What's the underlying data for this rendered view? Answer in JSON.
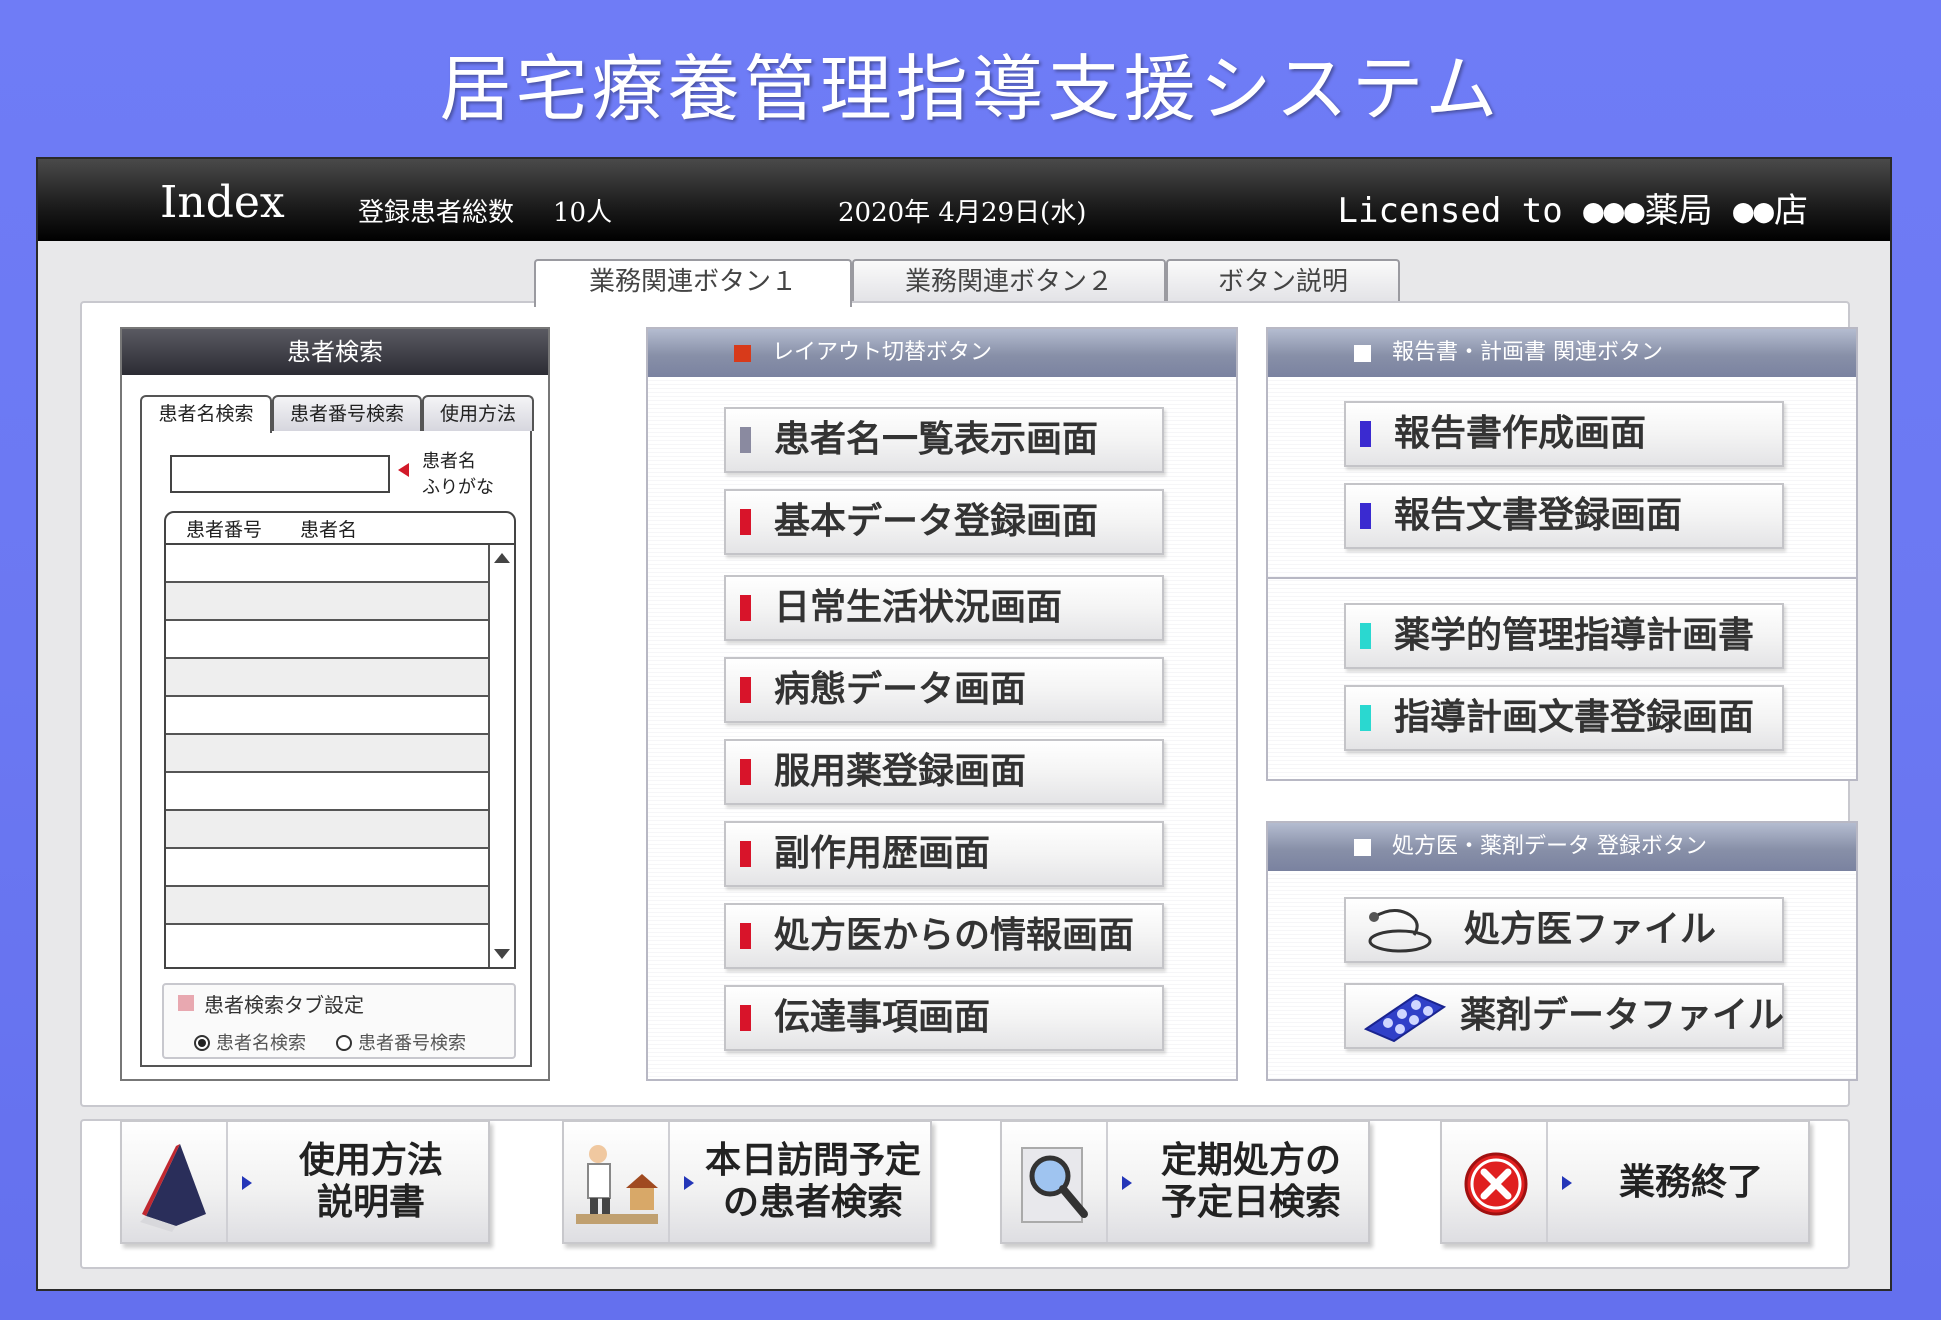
{
  "app_title": "居宅療養管理指導支援システム",
  "header": {
    "index": "Index",
    "count_label": "登録患者総数",
    "count_value": "10人",
    "date": "2020年 4月29日(水)",
    "license": "Licensed to ●●●薬局 ●●店"
  },
  "tabs": [
    "業務関連ボタン１",
    "業務関連ボタン２",
    "ボタン説明"
  ],
  "patient_search": {
    "title": "患者検索",
    "tabs": [
      "患者名検索",
      "患者番号検索",
      "使用方法"
    ],
    "hint_line1": "患者名",
    "hint_line2": "ふりがな",
    "col_number": "患者番号",
    "col_name": "患者名",
    "setting_title": "患者検索タブ設定",
    "option_name": "患者名検索",
    "option_number": "患者番号検索"
  },
  "layout_group": {
    "title": "レイアウト切替ボタン",
    "buttons": [
      "患者名一覧表示画面",
      "基本データ登録画面",
      "日常生活状況画面",
      "病態データ画面",
      "服用薬登録画面",
      "副作用歴画面",
      "処方医からの情報画面",
      "伝達事項画面"
    ]
  },
  "report_group": {
    "title": "報告書・計画書 関連ボタン",
    "buttons": [
      "報告書作成画面",
      "報告文書登録画面",
      "薬学的管理指導計画書",
      "指導計画文書登録画面"
    ]
  },
  "prescriber_group": {
    "title": "処方医・薬剤データ 登録ボタン",
    "buttons": [
      "処方医ファイル",
      "薬剤データファイル"
    ]
  },
  "actions": {
    "manual_line1": "使用方法",
    "manual_line2": "説明書",
    "visit_line1": "本日訪問予定",
    "visit_line2": "の患者検索",
    "regular_line1": "定期処方の",
    "regular_line2": "予定日検索",
    "exit": "業務終了"
  },
  "colors": {
    "layout_mark_first": "#8a8aa0",
    "layout_mark": "#d8142a",
    "report_mark": "#3a2ad0",
    "plan_mark": "#2ad8d0",
    "layout_head_square": "#d83a1a"
  }
}
